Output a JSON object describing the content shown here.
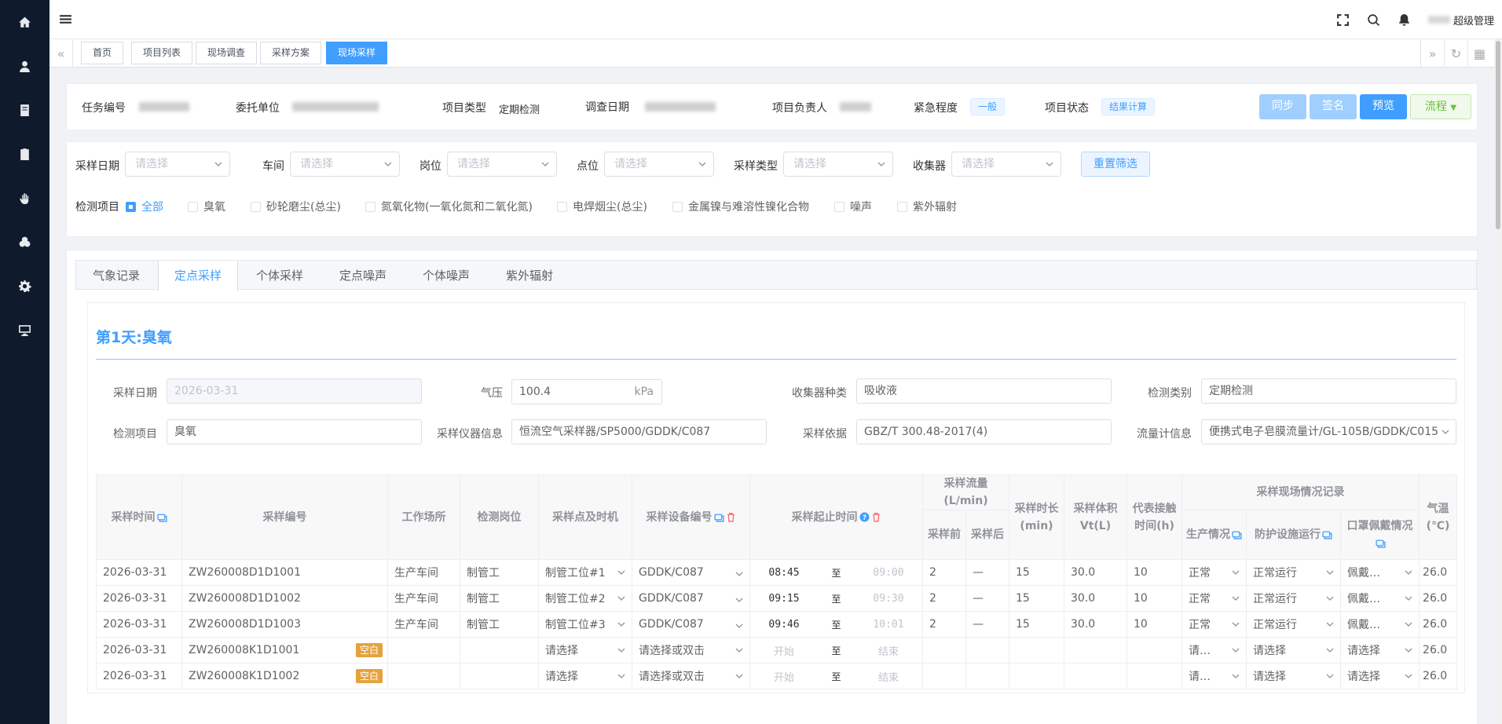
{
  "nav_icons": [
    "home-icon",
    "user-icon",
    "book-icon",
    "clipboard-check-icon",
    "hand-icon",
    "cogs-icon",
    "gear-icon",
    "monitor-icon"
  ],
  "header": {
    "user_label": "超级管理"
  },
  "tags": [
    "首页",
    "项目列表",
    "现场调查",
    "采样方案",
    "现场采样"
  ],
  "info": {
    "task_no_label": "任务编号",
    "client_label": "委托单位",
    "type_label": "项目类型",
    "type_value": "定期检测",
    "survey_date_label": "调查日期",
    "leader_label": "项目负责人",
    "urgency_label": "紧急程度",
    "urgency_value": "一般",
    "status_label": "项目状态",
    "status_value": "结果计算",
    "buttons": {
      "sync": "同步",
      "sign": "签名",
      "preview": "预览",
      "flow": "流程"
    }
  },
  "filters": {
    "date_label": "采样日期",
    "workshop_label": "车间",
    "post_label": "岗位",
    "point_label": "点位",
    "type_label": "采样类型",
    "collector_label": "收集器",
    "placeholder": "请选择",
    "reset": "重置筛选",
    "items_label": "检测项目",
    "items": [
      "全部",
      "臭氧",
      "砂轮磨尘(总尘)",
      "氮氧化物(一氧化氮和二氧化氮)",
      "电焊烟尘(总尘)",
      "金属镍与难溶性镍化合物",
      "噪声",
      "紫外辐射"
    ]
  },
  "tabs": [
    "气象记录",
    "定点采样",
    "个体采样",
    "定点噪声",
    "个体噪声",
    "紫外辐射"
  ],
  "section": {
    "title": "第1天:臭氧"
  },
  "form": {
    "date_label": "采样日期",
    "date_value": "2026-03-31",
    "pressure_label": "气压",
    "pressure_value": "100.4",
    "pressure_unit": "kPa",
    "collector_label": "收集器种类",
    "collector_value": "吸收液",
    "category_label": "检测类别",
    "category_value": "定期检测",
    "item_label": "检测项目",
    "item_value": "臭氧",
    "instrument_label": "采样仪器信息",
    "instrument_value": "恒流空气采样器/SP5000/GDDK/C087",
    "basis_label": "采样依据",
    "basis_value": "GBZ/T 300.48-2017(4)",
    "flowmeter_label": "流量计信息",
    "flowmeter_value": "便携式电子皂膜流量计/GL-105B/GDDK/C015"
  },
  "table": {
    "headers": {
      "time": "采样时间",
      "code": "采样编号",
      "site": "工作场所",
      "post": "检测岗位",
      "point": "采样点及时机",
      "equip": "采样设备编号",
      "startend": "采样起止时间",
      "flow": "采样流量(L/min)",
      "flow_before": "采样前",
      "flow_after": "采样后",
      "duration": "采样时长(min)",
      "volume": "采样体积Vt(L)",
      "exposure": "代表接触时间(h)",
      "scene": "采样现场情况记录",
      "production": "生产情况",
      "protect": "防护设施运行",
      "mask": "口罩佩戴情况",
      "temp": "气温(℃)"
    },
    "to": "至",
    "rows": [
      {
        "date": "2026-03-31",
        "code": "ZW260008D1D1001",
        "site": "生产车间",
        "post": "制管工",
        "point": "制管工位#1",
        "equip": "GDDK/C087",
        "start": "08:45",
        "end": "09:00",
        "before": "2",
        "after": "—",
        "duration": "15",
        "volume": "30.0",
        "exposure": "10",
        "production": "正常",
        "protect": "正常运行",
        "mask": "佩戴…",
        "temp": "26.0"
      },
      {
        "date": "2026-03-31",
        "code": "ZW260008D1D1002",
        "site": "生产车间",
        "post": "制管工",
        "point": "制管工位#2",
        "equip": "GDDK/C087",
        "start": "09:15",
        "end": "09:30",
        "before": "2",
        "after": "—",
        "duration": "15",
        "volume": "30.0",
        "exposure": "10",
        "production": "正常",
        "protect": "正常运行",
        "mask": "佩戴…",
        "temp": "26.0"
      },
      {
        "date": "2026-03-31",
        "code": "ZW260008D1D1003",
        "site": "生产车间",
        "post": "制管工",
        "point": "制管工位#3",
        "equip": "GDDK/C087",
        "start": "09:46",
        "end": "10:01",
        "before": "2",
        "after": "—",
        "duration": "15",
        "volume": "30.0",
        "exposure": "10",
        "production": "正常",
        "protect": "正常运行",
        "mask": "佩戴…",
        "temp": "26.0"
      },
      {
        "date": "2026-03-31",
        "code": "ZW260008K1D1001",
        "empty": "空白",
        "point": "请选择",
        "equip": "请选择或双击",
        "start": "开始",
        "end": "结束",
        "production": "请…",
        "protect": "请选择",
        "mask": "请选择",
        "temp": "26.0"
      },
      {
        "date": "2026-03-31",
        "code": "ZW260008K1D1002",
        "empty": "空白",
        "point": "请选择",
        "equip": "请选择或双击",
        "start": "开始",
        "end": "结束",
        "production": "请…",
        "protect": "请选择",
        "mask": "请选择",
        "temp": "26.0"
      }
    ]
  },
  "colors": {
    "primary": "#409eff",
    "sidebar": "#0f1b2d",
    "warning": "#e6a23c",
    "success": "#67c23a"
  }
}
